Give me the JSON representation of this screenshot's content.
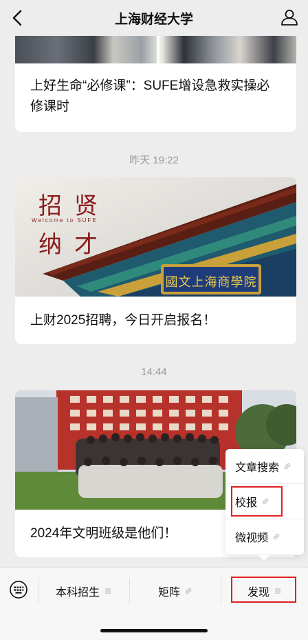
{
  "header": {
    "title": "上海财经大学"
  },
  "articles": [
    {
      "title": "上好生命“必修课”：SUFE增设急救实操必修课时"
    },
    {
      "time": "昨天 19:22",
      "title": "上财2025招聘，今日开启报名！",
      "banner": {
        "line1_a": "招",
        "line1_b": "贤",
        "subtitle": "Welcome to SUFE",
        "line2_a": "纳",
        "line2_b": "才",
        "plaque": "國文上海商學院"
      }
    },
    {
      "time": "14:44",
      "title": "2024年文明班级是他们！"
    }
  ],
  "popup": {
    "items": [
      "文章搜索",
      "校报",
      "微视频"
    ]
  },
  "bottom_menu": {
    "items": [
      "本科招生",
      "矩阵",
      "发现"
    ]
  },
  "colors": {
    "highlight": "#e02020",
    "accent_red": "#8b1c1c"
  }
}
